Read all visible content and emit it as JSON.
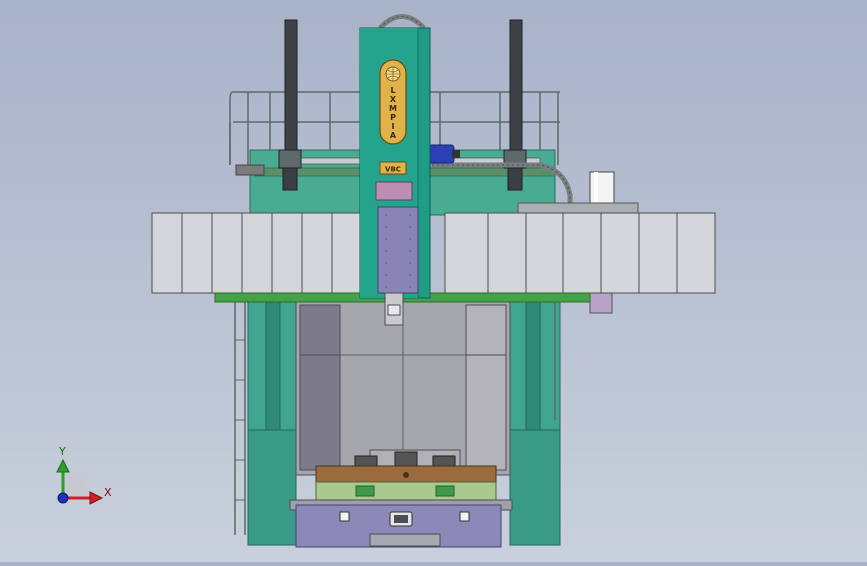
{
  "machine": {
    "logo_letters": [
      "L",
      "X",
      "M",
      "P",
      "I",
      "A"
    ],
    "plate_label": "VBC"
  },
  "triad": {
    "y_label": "Y",
    "x_label": "X"
  },
  "colors": {
    "background_top": "#a9b3c8",
    "background_bottom": "#c9d0dc",
    "machine_teal": "#3fa58f",
    "column_teal": "#1f9c86",
    "panel_gray": "#d6d6d8",
    "green_strip": "#45a24a",
    "ram_purple": "#8b84b6",
    "table_brown": "#9a6b3c",
    "base_lavender": "#8c88b8",
    "logo_gold": "#e0b34a",
    "axis_x": "#d0202a",
    "axis_y": "#2aa02a",
    "axis_z": "#2030c0"
  }
}
